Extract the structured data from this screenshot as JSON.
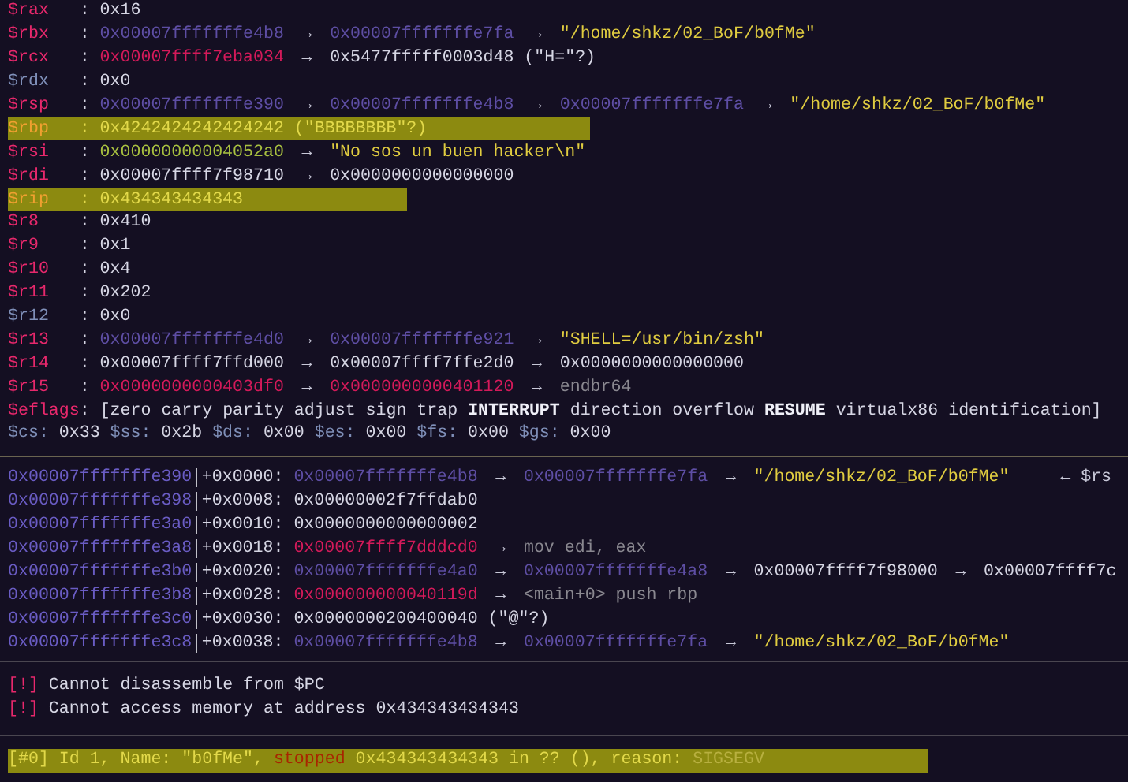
{
  "registers": [
    {
      "name": "$rax",
      "colon": ":",
      "changed": true,
      "highlighted": false,
      "parts": [
        {
          "kind": "value",
          "text": "0x16"
        }
      ]
    },
    {
      "name": "$rbx",
      "colon": ":",
      "changed": true,
      "highlighted": false,
      "parts": [
        {
          "kind": "stack",
          "text": "0x00007fffffffe4b8"
        },
        {
          "kind": "arrow",
          "text": "→"
        },
        {
          "kind": "stack",
          "text": "0x00007fffffffe7fa"
        },
        {
          "kind": "arrow",
          "text": "→"
        },
        {
          "kind": "string",
          "text": "\"/home/shkz/02_BoF/b0fMe\""
        }
      ]
    },
    {
      "name": "$rcx",
      "colon": ":",
      "changed": true,
      "highlighted": false,
      "parts": [
        {
          "kind": "code",
          "text": "0x00007ffff7eba034"
        },
        {
          "kind": "arrow",
          "text": "→"
        },
        {
          "kind": "value",
          "text": "0x5477fffff0003d48 (\"H=\"?)"
        }
      ]
    },
    {
      "name": "$rdx",
      "colon": ":",
      "changed": false,
      "highlighted": false,
      "parts": [
        {
          "kind": "value",
          "text": "0x0"
        }
      ]
    },
    {
      "name": "$rsp",
      "colon": ":",
      "changed": true,
      "highlighted": false,
      "parts": [
        {
          "kind": "stack",
          "text": "0x00007fffffffe390"
        },
        {
          "kind": "arrow",
          "text": "→"
        },
        {
          "kind": "stack",
          "text": "0x00007fffffffe4b8"
        },
        {
          "kind": "arrow",
          "text": "→"
        },
        {
          "kind": "stack",
          "text": "0x00007fffffffe7fa"
        },
        {
          "kind": "arrow",
          "text": "→"
        },
        {
          "kind": "string",
          "text": "\"/home/shkz/02_BoF/b0fMe\""
        }
      ]
    },
    {
      "name": "$rbp",
      "colon": ":",
      "changed": true,
      "highlighted": true,
      "parts": [
        {
          "kind": "value",
          "text": "0x4242424242424242 (\"BBBBBBBB\"?)"
        }
      ]
    },
    {
      "name": "$rsi",
      "colon": ":",
      "changed": true,
      "highlighted": false,
      "parts": [
        {
          "kind": "data",
          "text": "0x00000000004052a0"
        },
        {
          "kind": "arrow",
          "text": "→"
        },
        {
          "kind": "string",
          "text": "\"No sos un buen hacker\\n\""
        }
      ]
    },
    {
      "name": "$rdi",
      "colon": ":",
      "changed": true,
      "highlighted": false,
      "parts": [
        {
          "kind": "value",
          "text": "0x00007ffff7f98710"
        },
        {
          "kind": "arrow",
          "text": "→"
        },
        {
          "kind": "value",
          "text": "0x0000000000000000"
        }
      ]
    },
    {
      "name": "$rip",
      "colon": ":",
      "changed": true,
      "highlighted": true,
      "parts": [
        {
          "kind": "value",
          "text": "0x434343434343"
        }
      ]
    },
    {
      "name": "$r8",
      "colon": ":",
      "changed": true,
      "highlighted": false,
      "parts": [
        {
          "kind": "value",
          "text": "0x410"
        }
      ]
    },
    {
      "name": "$r9",
      "colon": ":",
      "changed": true,
      "highlighted": false,
      "parts": [
        {
          "kind": "value",
          "text": "0x1"
        }
      ]
    },
    {
      "name": "$r10",
      "colon": ":",
      "changed": true,
      "highlighted": false,
      "parts": [
        {
          "kind": "value",
          "text": "0x4"
        }
      ]
    },
    {
      "name": "$r11",
      "colon": ":",
      "changed": true,
      "highlighted": false,
      "parts": [
        {
          "kind": "value",
          "text": "0x202"
        }
      ]
    },
    {
      "name": "$r12",
      "colon": ":",
      "changed": false,
      "highlighted": false,
      "parts": [
        {
          "kind": "value",
          "text": "0x0"
        }
      ]
    },
    {
      "name": "$r13",
      "colon": ":",
      "changed": true,
      "highlighted": false,
      "parts": [
        {
          "kind": "stack",
          "text": "0x00007fffffffe4d0"
        },
        {
          "kind": "arrow",
          "text": "→"
        },
        {
          "kind": "stack",
          "text": "0x00007fffffffe921"
        },
        {
          "kind": "arrow",
          "text": "→"
        },
        {
          "kind": "string",
          "text": "\"SHELL=/usr/bin/zsh\""
        }
      ]
    },
    {
      "name": "$r14",
      "colon": ":",
      "changed": true,
      "highlighted": false,
      "parts": [
        {
          "kind": "value",
          "text": "0x00007ffff7ffd000"
        },
        {
          "kind": "arrow",
          "text": "→"
        },
        {
          "kind": "value",
          "text": "0x00007ffff7ffe2d0"
        },
        {
          "kind": "arrow",
          "text": "→"
        },
        {
          "kind": "value",
          "text": "0x0000000000000000"
        }
      ]
    },
    {
      "name": "$r15",
      "colon": ":",
      "changed": true,
      "highlighted": false,
      "parts": [
        {
          "kind": "code",
          "text": "0x0000000000403df0"
        },
        {
          "kind": "arrow",
          "text": "→"
        },
        {
          "kind": "code",
          "text": "0x0000000000401120"
        },
        {
          "kind": "arrow",
          "text": "→"
        },
        {
          "kind": "instr",
          "text": "endbr64"
        }
      ]
    },
    {
      "name": "$eflags",
      "colon": ":",
      "changed": true,
      "highlighted": false,
      "parts": [
        {
          "kind": "value",
          "text": "[zero carry parity adjust sign trap"
        },
        {
          "kind": "flag",
          "text": "INTERRUPT"
        },
        {
          "kind": "value",
          "text": "direction overflow"
        },
        {
          "kind": "flag",
          "text": "RESUME"
        },
        {
          "kind": "value",
          "text": "virtualx86 identification]"
        }
      ]
    }
  ],
  "segment_registers": [
    {
      "name": "$cs:",
      "value": "0x33"
    },
    {
      "name": "$ss:",
      "value": "0x2b"
    },
    {
      "name": "$ds:",
      "value": "0x00"
    },
    {
      "name": "$es:",
      "value": "0x00"
    },
    {
      "name": "$fs:",
      "value": "0x00"
    },
    {
      "name": "$gs:",
      "value": "0x00"
    }
  ],
  "stack": [
    {
      "address": "0x00007fffffffe390",
      "offset": "+0x0000:",
      "parts": [
        {
          "kind": "stack",
          "text": "0x00007fffffffe4b8"
        },
        {
          "kind": "arrow",
          "text": "→"
        },
        {
          "kind": "stack",
          "text": "0x00007fffffffe7fa"
        },
        {
          "kind": "arrow",
          "text": "→"
        },
        {
          "kind": "string",
          "text": "\"/home/shkz/02_BoF/b0fMe\""
        },
        {
          "kind": "note",
          "text": "← $rs"
        }
      ]
    },
    {
      "address": "0x00007fffffffe398",
      "offset": "+0x0008:",
      "parts": [
        {
          "kind": "value",
          "text": "0x00000002f7ffdab0"
        }
      ]
    },
    {
      "address": "0x00007fffffffe3a0",
      "offset": "+0x0010:",
      "parts": [
        {
          "kind": "value",
          "text": "0x0000000000000002"
        }
      ]
    },
    {
      "address": "0x00007fffffffe3a8",
      "offset": "+0x0018:",
      "parts": [
        {
          "kind": "code",
          "text": "0x00007ffff7dddcd0"
        },
        {
          "kind": "arrow",
          "text": "→"
        },
        {
          "kind": "instr",
          "text": "mov edi, eax"
        }
      ]
    },
    {
      "address": "0x00007fffffffe3b0",
      "offset": "+0x0020:",
      "parts": [
        {
          "kind": "stack",
          "text": "0x00007fffffffe4a0"
        },
        {
          "kind": "arrow",
          "text": "→"
        },
        {
          "kind": "stack",
          "text": "0x00007fffffffe4a8"
        },
        {
          "kind": "arrow",
          "text": "→"
        },
        {
          "kind": "value",
          "text": "0x00007ffff7f98000"
        },
        {
          "kind": "arrow",
          "text": "→"
        },
        {
          "kind": "value",
          "text": "0x00007ffff7c"
        }
      ]
    },
    {
      "address": "0x00007fffffffe3b8",
      "offset": "+0x0028:",
      "parts": [
        {
          "kind": "code",
          "text": "0x000000000040119d"
        },
        {
          "kind": "arrow",
          "text": "→"
        },
        {
          "kind": "instr",
          "text": "<main+0> push rbp"
        }
      ]
    },
    {
      "address": "0x00007fffffffe3c0",
      "offset": "+0x0030:",
      "parts": [
        {
          "kind": "value",
          "text": "0x0000000200400040 (\"@\"?)"
        }
      ]
    },
    {
      "address": "0x00007fffffffe3c8",
      "offset": "+0x0038:",
      "parts": [
        {
          "kind": "stack",
          "text": "0x00007fffffffe4b8"
        },
        {
          "kind": "arrow",
          "text": "→"
        },
        {
          "kind": "stack",
          "text": "0x00007fffffffe7fa"
        },
        {
          "kind": "arrow",
          "text": "→"
        },
        {
          "kind": "string",
          "text": "\"/home/shkz/02_BoF/b0fMe\""
        }
      ]
    }
  ],
  "messages": [
    {
      "mark": "[!]",
      "text": "Cannot disassemble from $PC"
    },
    {
      "mark": "[!]",
      "text": "Cannot access memory at address 0x434343434343"
    }
  ],
  "thread": {
    "highlighted": true,
    "parts": [
      {
        "kind": "value",
        "text": "[#0]"
      },
      {
        "kind": "value",
        "text": "Id 1, Name: \"b0fMe\","
      },
      {
        "kind": "stopped",
        "text": "stopped"
      },
      {
        "kind": "value",
        "text": "0x434343434343 in ?? (), reason:"
      },
      {
        "kind": "signal",
        "text": "SIGSEGV"
      }
    ]
  }
}
